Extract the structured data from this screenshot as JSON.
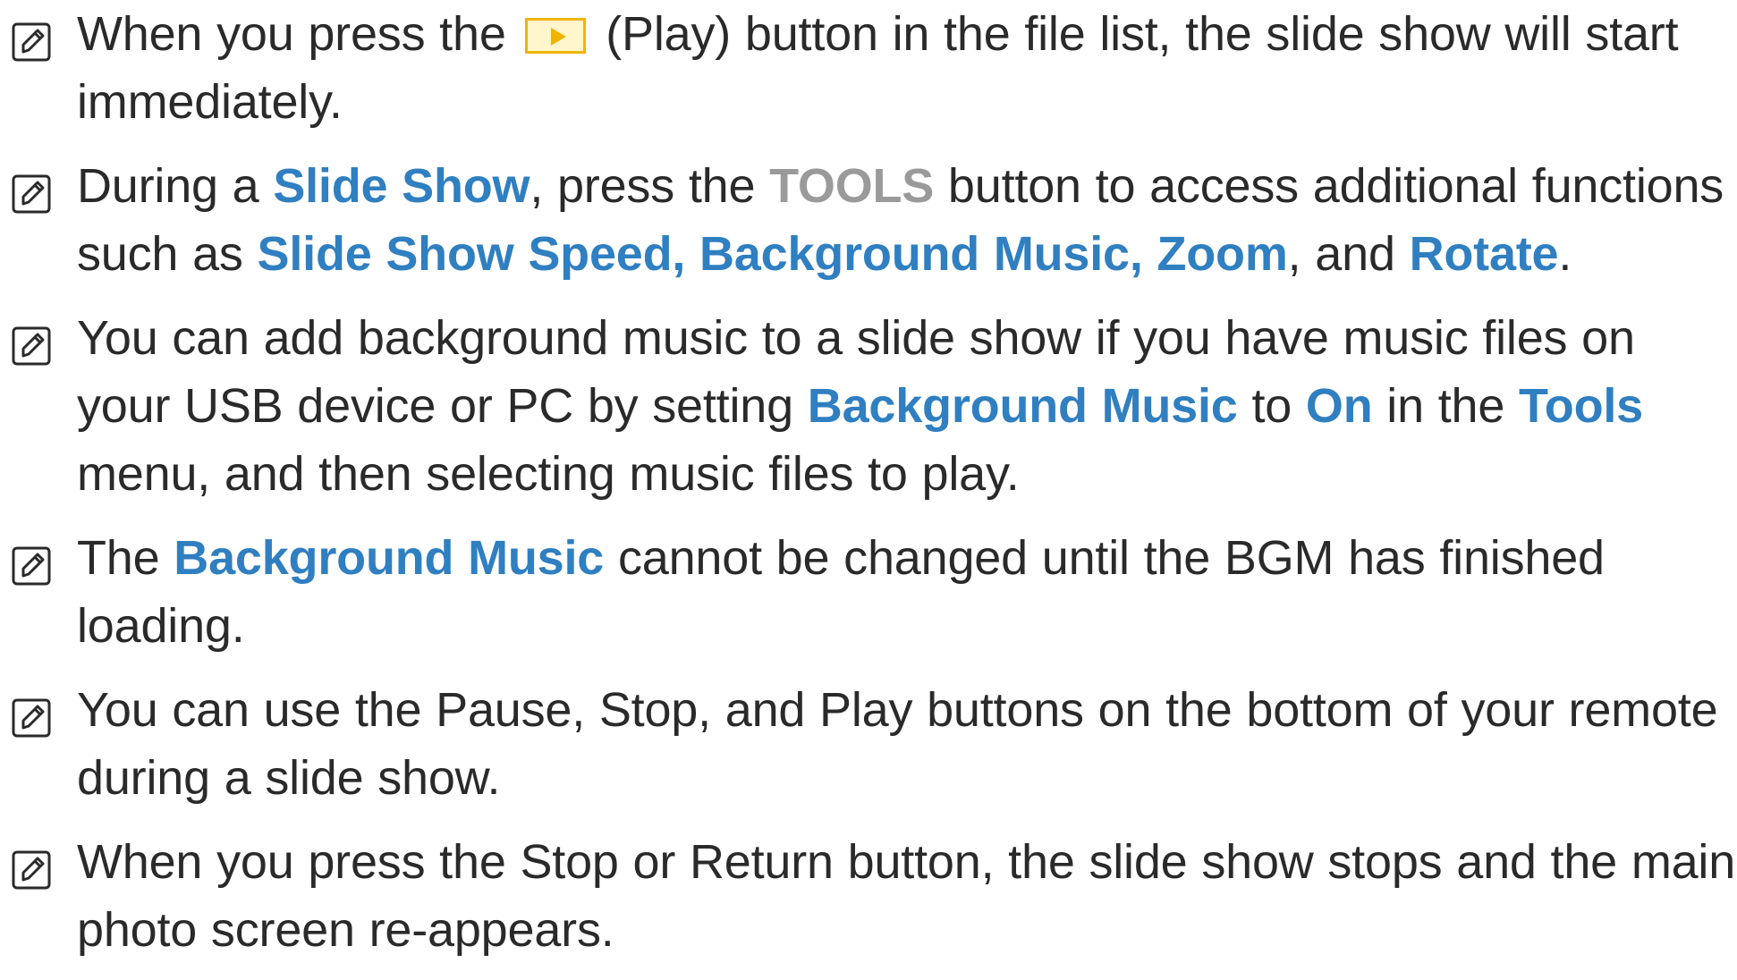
{
  "notes": [
    {
      "segments": [
        {
          "text": "When you press the ",
          "style": "normal"
        },
        {
          "icon": "play-button-icon"
        },
        {
          "text": " (Play) button in the file list, the slide show will start immediately.",
          "style": "normal"
        }
      ]
    },
    {
      "segments": [
        {
          "text": "During a ",
          "style": "normal"
        },
        {
          "text": "Slide Show",
          "style": "highlight"
        },
        {
          "text": ", press the ",
          "style": "normal"
        },
        {
          "text": "TOOLS",
          "style": "gray-bold"
        },
        {
          "text": " button to access additional functions such as ",
          "style": "normal"
        },
        {
          "text": "Slide Show Speed, Background Music, Zoom",
          "style": "highlight"
        },
        {
          "text": ", and ",
          "style": "normal"
        },
        {
          "text": "Rotate",
          "style": "highlight"
        },
        {
          "text": ".",
          "style": "normal"
        }
      ]
    },
    {
      "segments": [
        {
          "text": "You can add background music to a slide show if you have music files on your USB device or PC by setting ",
          "style": "normal"
        },
        {
          "text": "Background Music",
          "style": "highlight"
        },
        {
          "text": " to ",
          "style": "normal"
        },
        {
          "text": "On",
          "style": "highlight"
        },
        {
          "text": " in the ",
          "style": "normal"
        },
        {
          "text": "Tools",
          "style": "highlight"
        },
        {
          "text": " menu, and then selecting music files to play.",
          "style": "normal"
        }
      ]
    },
    {
      "segments": [
        {
          "text": "The ",
          "style": "normal"
        },
        {
          "text": "Background Music",
          "style": "highlight"
        },
        {
          "text": " cannot be changed until the BGM has finished loading.",
          "style": "normal"
        }
      ]
    },
    {
      "segments": [
        {
          "text": "You can use the Pause, Stop, and Play buttons on the bottom of your remote during a slide show.",
          "style": "normal"
        }
      ]
    },
    {
      "segments": [
        {
          "text": "When you press the Stop or Return button, the slide show stops and the main photo screen re-appears.",
          "style": "normal"
        }
      ]
    }
  ],
  "colors": {
    "highlight": "#2f7fc1",
    "gray_bold": "#9a9a9a",
    "body_text": "#2a2a2a",
    "play_icon_border": "#f0b400",
    "play_icon_fill": "#fff6cc"
  }
}
